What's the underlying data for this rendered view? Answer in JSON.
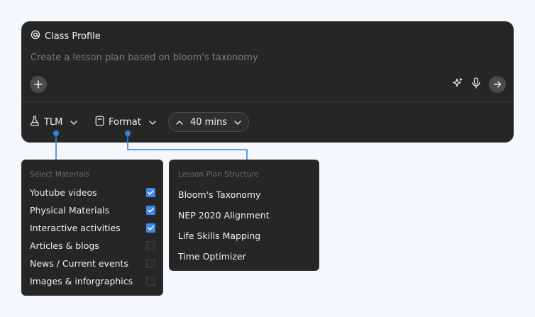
{
  "composer": {
    "profile_label": "Class Profile",
    "prompt_text": "Create a lesson plan based on bloom's taxonomy",
    "icons": [
      "at-icon",
      "plus-icon",
      "sparkle-icon",
      "mic-icon",
      "arrow-right-icon"
    ]
  },
  "toolbar": {
    "tlm_label": "TLM",
    "format_label": "Format",
    "duration_label": "40 mins"
  },
  "materials": {
    "title": "Select Materials",
    "items": [
      {
        "label": "Youtube videos",
        "checked": true
      },
      {
        "label": "Physical Materials",
        "checked": true
      },
      {
        "label": "Interactive activities",
        "checked": true
      },
      {
        "label": "Articles & blogs",
        "checked": false
      },
      {
        "label": "News / Current events",
        "checked": false
      },
      {
        "label": "Images & inforgraphics",
        "checked": false
      }
    ]
  },
  "format_menu": {
    "title": "Lesson Plan Structure",
    "items": [
      "Bloom's Taxonomy",
      "NEP 2020 Alignment",
      "Life Skills Mapping",
      "Time Optimizer"
    ]
  },
  "colors": {
    "background": "#f4f8fd",
    "panel": "#262626",
    "accent": "#3d8ae8",
    "connector": "#2f86e0"
  }
}
